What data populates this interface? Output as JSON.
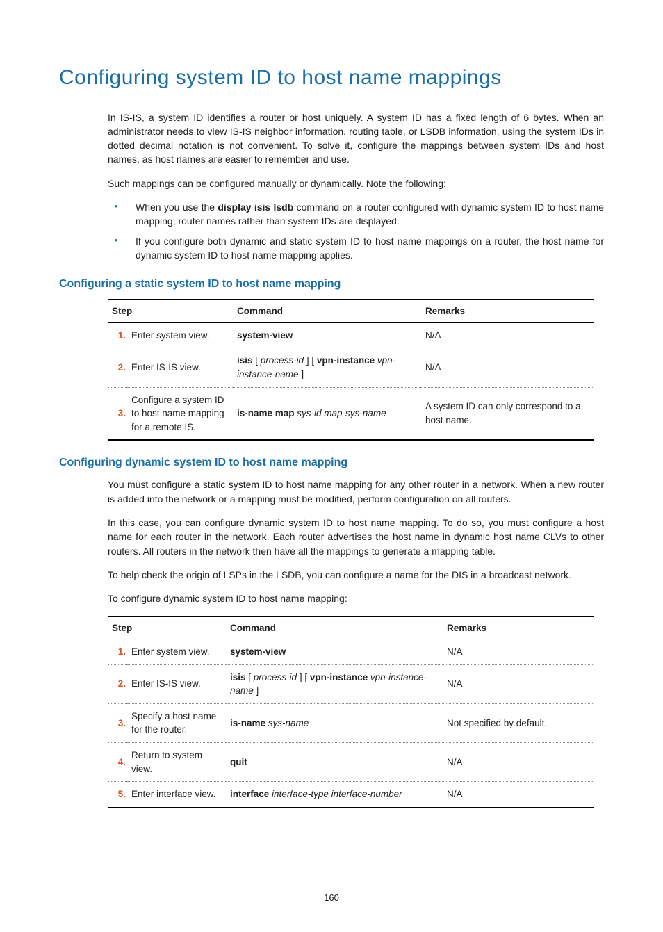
{
  "title": "Configuring system ID to host name mappings",
  "intro": {
    "p1": "In IS-IS, a system ID identifies a router or host uniquely. A system ID has a fixed length of 6 bytes. When an administrator needs to view IS-IS neighbor information, routing table, or LSDB information, using the system IDs in dotted decimal notation is not convenient. To solve it, configure the mappings between system IDs and host names, as host names are easier to remember and use.",
    "p2": "Such mappings can be configured manually or dynamically. Note the following:",
    "bullet1a": "When you use the ",
    "bullet1b": "display isis lsdb",
    "bullet1c": " command on a router configured with dynamic system ID to host name mapping, router names rather than system IDs are displayed.",
    "bullet2": "If you configure both dynamic and static system ID to host name mappings on a router, the host name for dynamic system ID to host name mapping applies."
  },
  "static": {
    "heading": "Configuring a static system ID to host name mapping",
    "table": {
      "headers": {
        "step": "Step",
        "command": "Command",
        "remarks": "Remarks"
      },
      "rows": [
        {
          "num": "1.",
          "step": "Enter system view.",
          "cmd": {
            "b1": "system-view"
          },
          "remarks": "N/A"
        },
        {
          "num": "2.",
          "step": "Enter IS-IS view.",
          "cmd": {
            "b1": "isis",
            "t1": " [ ",
            "i1": "process-id",
            "t2": " ] [ ",
            "b2": "vpn-instance",
            "t3": " ",
            "i2": "vpn-instance-name",
            "t4": " ]"
          },
          "remarks": "N/A"
        },
        {
          "num": "3.",
          "step": "Configure a system ID to host name mapping for a remote IS.",
          "cmd": {
            "b1": "is-name map",
            "t1": " ",
            "i1": "sys-id map-sys-name"
          },
          "remarks": "A system ID can only correspond to a host name."
        }
      ]
    }
  },
  "dynamic": {
    "heading": "Configuring dynamic system ID to host name mapping",
    "p1": "You must configure a static system ID to host name mapping for any other router in a network. When a new router is added into the network or a mapping must be modified, perform configuration on all routers.",
    "p2": "In this case, you can configure dynamic system ID to host name mapping. To do so, you must configure a host name for each router in the network. Each router advertises the host name in dynamic host name CLVs to other routers. All routers in the network then have all the mappings to generate a mapping table.",
    "p3": "To help check the origin of LSPs in the LSDB, you can configure a name for the DIS in a broadcast network.",
    "p4": "To configure dynamic system ID to host name mapping:",
    "table": {
      "headers": {
        "step": "Step",
        "command": "Command",
        "remarks": "Remarks"
      },
      "rows": [
        {
          "num": "1.",
          "step": "Enter system view.",
          "cmd": {
            "b1": "system-view"
          },
          "remarks": "N/A"
        },
        {
          "num": "2.",
          "step": "Enter IS-IS view.",
          "cmd": {
            "b1": "isis",
            "t1": " [ ",
            "i1": "process-id",
            "t2": " ] [ ",
            "b2": "vpn-instance",
            "t3": " ",
            "i2": "vpn-instance-name",
            "t4": " ]"
          },
          "remarks": "N/A"
        },
        {
          "num": "3.",
          "step": "Specify a host name for the router.",
          "cmd": {
            "b1": "is-name",
            "t1": " ",
            "i1": "sys-name"
          },
          "remarks": "Not specified by default."
        },
        {
          "num": "4.",
          "step": "Return to system view.",
          "cmd": {
            "b1": "quit"
          },
          "remarks": "N/A"
        },
        {
          "num": "5.",
          "step": "Enter interface view.",
          "cmd": {
            "b1": "interface",
            "t1": " ",
            "i1": "interface-type interface-number"
          },
          "remarks": "N/A"
        }
      ]
    }
  },
  "pagenum": "160"
}
